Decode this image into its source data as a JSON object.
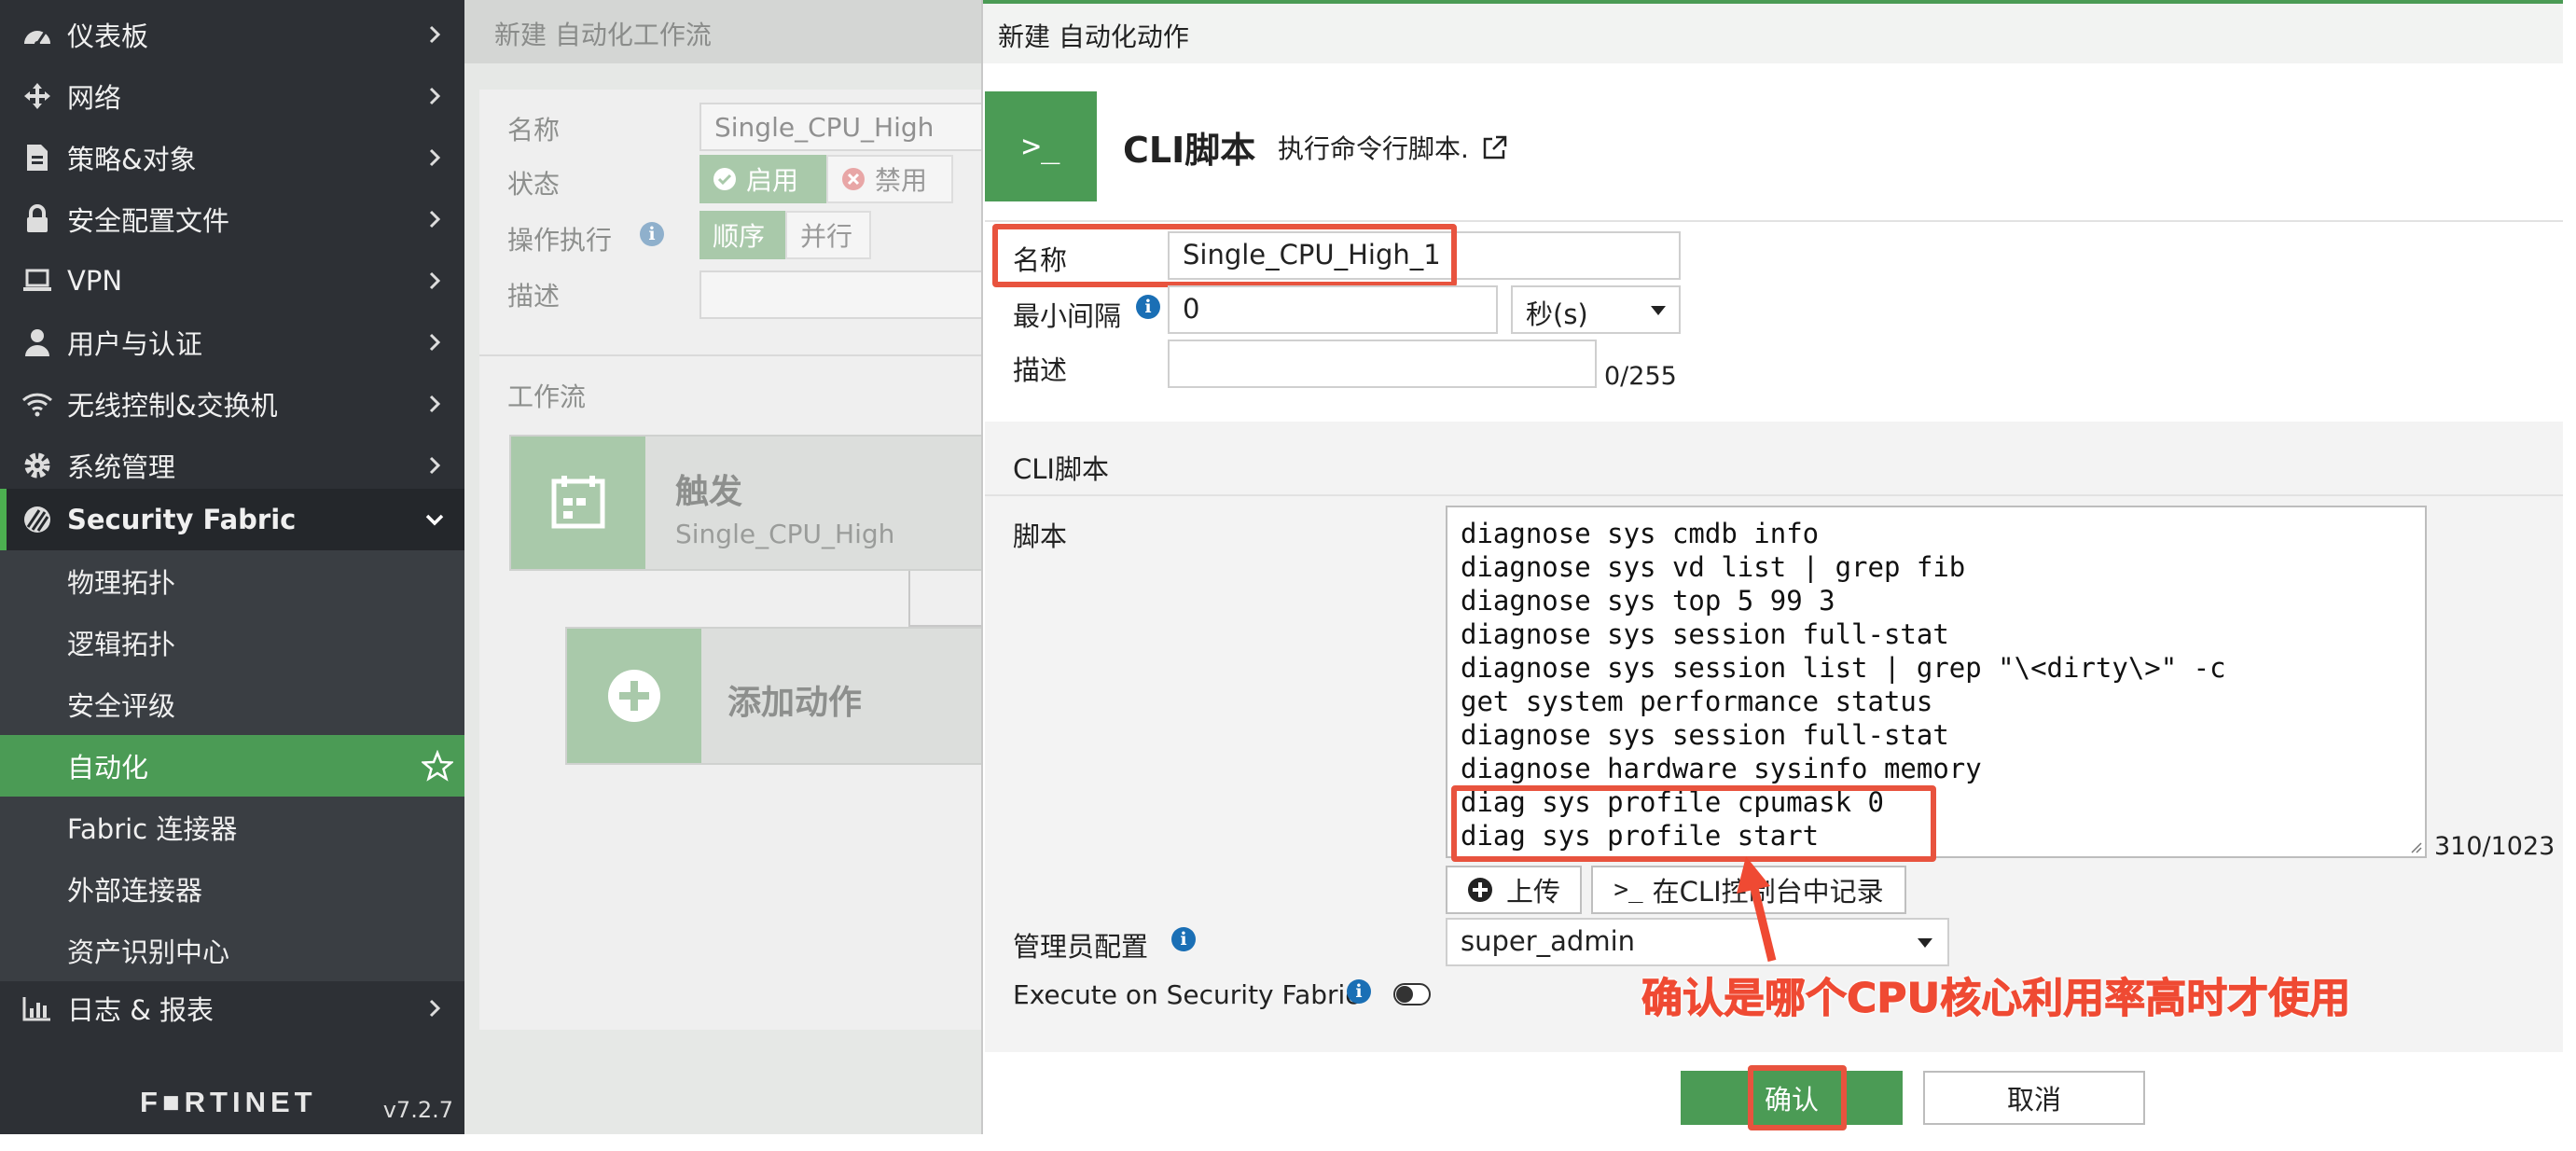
{
  "sidebar": {
    "items": [
      {
        "label": "仪表板",
        "icon": "dashboard-icon"
      },
      {
        "label": "网络",
        "icon": "network-arrows-icon"
      },
      {
        "label": "策略&对象",
        "icon": "policy-doc-icon"
      },
      {
        "label": "安全配置文件",
        "icon": "lock-icon"
      },
      {
        "label": "VPN",
        "icon": "laptop-icon"
      },
      {
        "label": "用户与认证",
        "icon": "user-icon"
      },
      {
        "label": "无线控制&交换机",
        "icon": "wifi-icon"
      },
      {
        "label": "系统管理",
        "icon": "gear-icon"
      },
      {
        "label": "Security Fabric",
        "icon": "fabric-icon"
      }
    ],
    "sub_items": [
      "物理拓扑",
      "逻辑拓扑",
      "安全评级",
      "自动化",
      "Fabric 连接器",
      "外部连接器",
      "资产识别中心"
    ],
    "last_item": {
      "label": "日志 & 报表",
      "icon": "chart-icon"
    },
    "logo": "F■RTINET",
    "version": "v7.2.7"
  },
  "workflow": {
    "header": "新建 自动化工作流",
    "name_label": "名称",
    "name_value": "Single_CPU_High",
    "status_label": "状态",
    "enable_label": "启用",
    "disable_label": "禁用",
    "exec_label": "操作执行",
    "sequential_label": "顺序",
    "parallel_label": "并行",
    "desc_label": "描述",
    "workflow_label": "工作流",
    "trigger_title": "触发",
    "trigger_sub": "Single_CPU_High",
    "add_action": "添加动作"
  },
  "dialog": {
    "title": "新建 自动化动作",
    "cli_icon": ">_",
    "cli_title": "CLI脚本",
    "cli_desc": "执行命令行脚本.",
    "name_label": "名称",
    "name_value": "Single_CPU_High_1",
    "min_interval_label": "最小间隔",
    "min_interval_value": "0",
    "interval_unit": "秒(s)",
    "desc_label": "描述",
    "desc_counter": "0/255",
    "section_title": "CLI脚本",
    "script_label": "脚本",
    "script_lines": [
      "diagnose sys cmdb info",
      "diagnose sys vd list | grep fib",
      "diagnose sys top 5 99 3",
      "diagnose sys session full-stat",
      "diagnose sys session list | grep \"\\<dirty\\>\" -c",
      "get system performance status",
      "diagnose sys session full-stat",
      "diagnose hardware sysinfo memory",
      "diag sys profile cpumask 0",
      "diag sys profile start"
    ],
    "script_counter": "310/1023",
    "upload_label": "上传",
    "record_label": "在CLI控制台中记录",
    "admin_label": "管理员配置",
    "admin_value": "super_admin",
    "fabric_label": "Execute on Security Fabric",
    "confirm_label": "确认",
    "cancel_label": "取消",
    "annotation": "确认是哪个CPU核心利用率高时才使用"
  },
  "colors": {
    "accent_green": "#4b9b55",
    "sidebar_bg": "#2d3035",
    "highlight_red": "#e8533e",
    "info_blue": "#1a6fb5"
  }
}
